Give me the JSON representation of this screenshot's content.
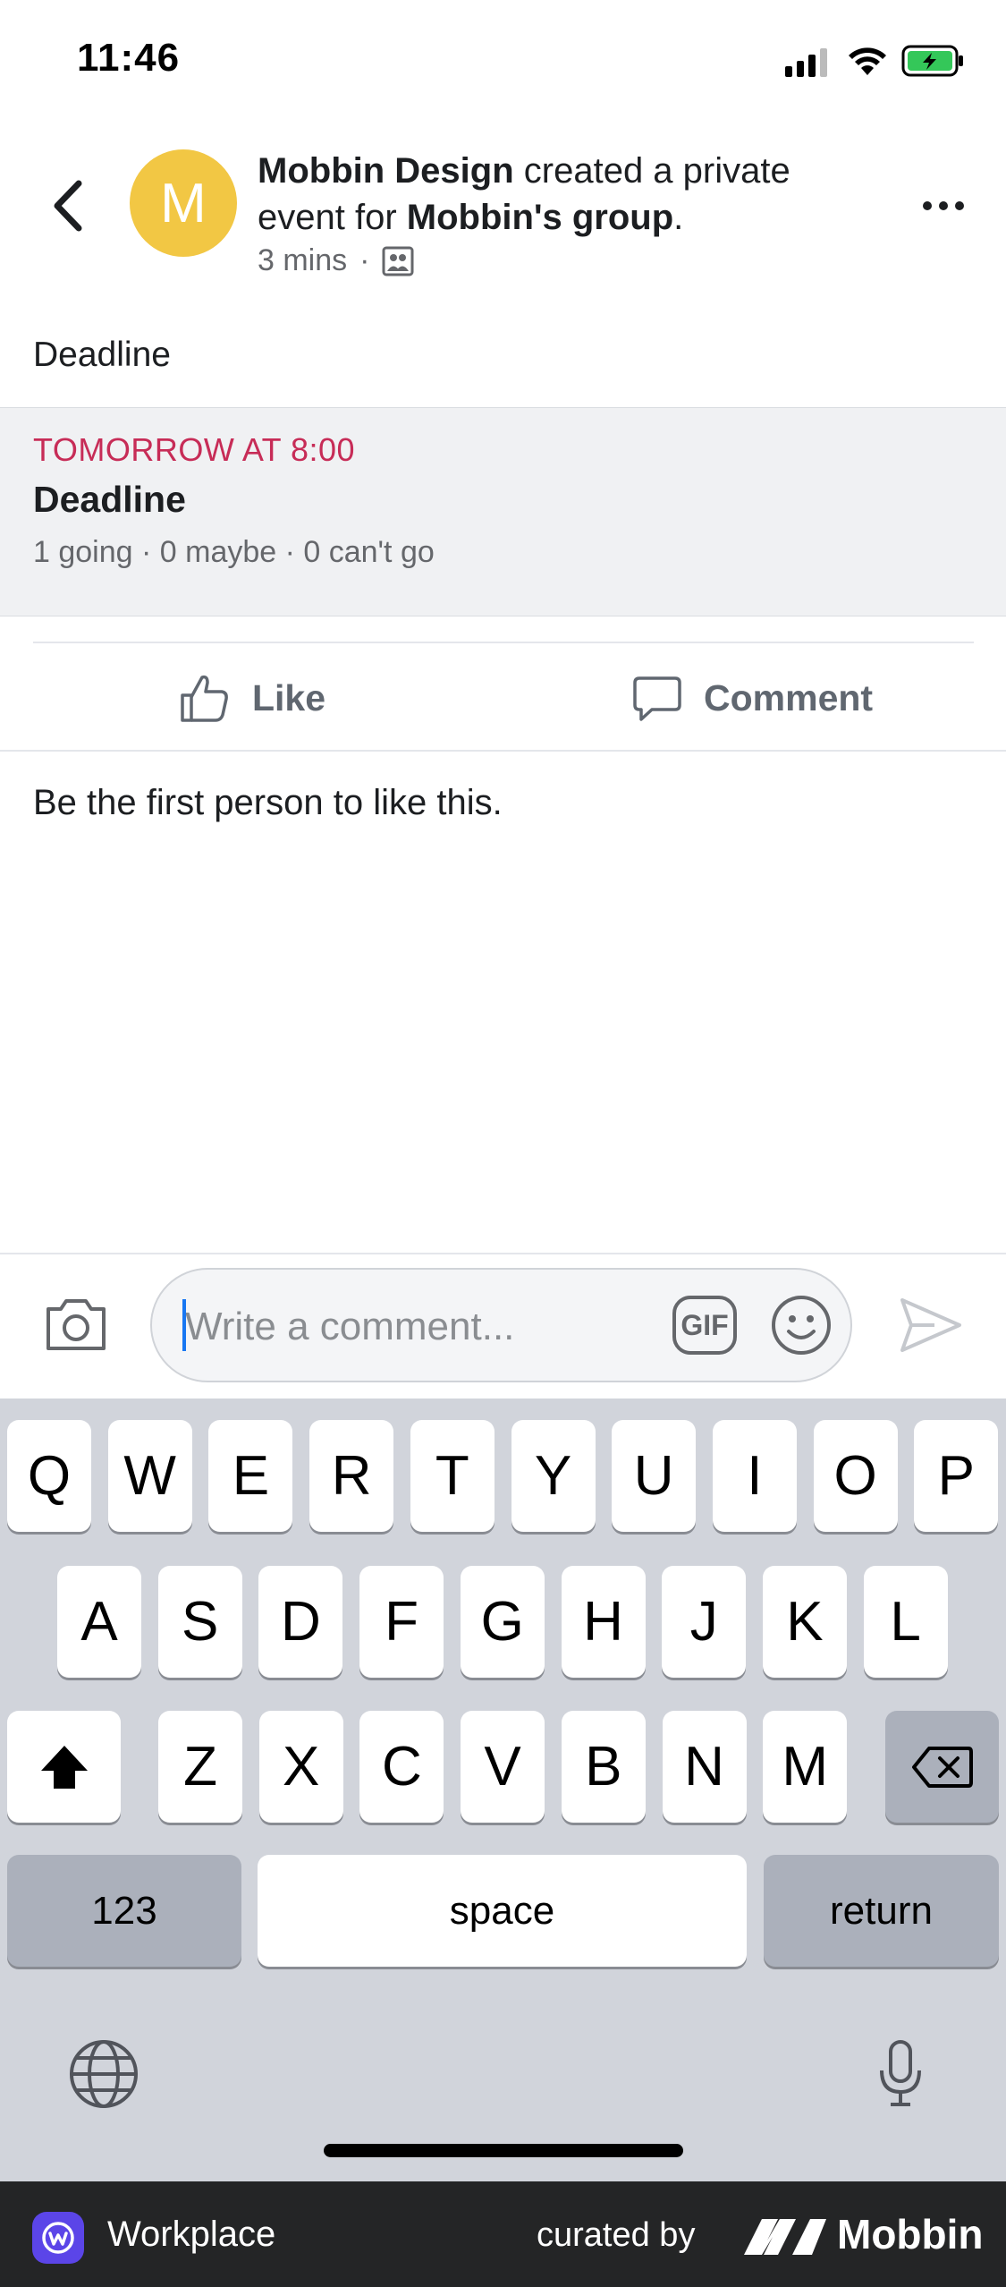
{
  "status_bar": {
    "time": "11:46"
  },
  "post": {
    "avatar_letter": "M",
    "author": "Mobbin Design",
    "action_text": "created a private event for",
    "group": "Mobbin's group",
    "period": ".",
    "time_ago": "3 mins",
    "separator": "·",
    "body": "Deadline"
  },
  "event": {
    "date": "TOMORROW AT 8:00",
    "title": "Deadline",
    "stats": "1 going · 0 maybe · 0 can't go"
  },
  "actions": {
    "like": "Like",
    "comment": "Comment"
  },
  "likes_note": "Be the first person to like this.",
  "composer": {
    "placeholder": "Write a comment...",
    "gif": "GIF"
  },
  "keyboard": {
    "row1": [
      "Q",
      "W",
      "E",
      "R",
      "T",
      "Y",
      "U",
      "I",
      "O",
      "P"
    ],
    "row2": [
      "A",
      "S",
      "D",
      "F",
      "G",
      "H",
      "J",
      "K",
      "L"
    ],
    "row3": [
      "Z",
      "X",
      "C",
      "V",
      "B",
      "N",
      "M"
    ],
    "numbers": "123",
    "space": "space",
    "return": "return"
  },
  "footer": {
    "app": "Workplace",
    "curated": "curated by",
    "brand": "Mobbin"
  }
}
